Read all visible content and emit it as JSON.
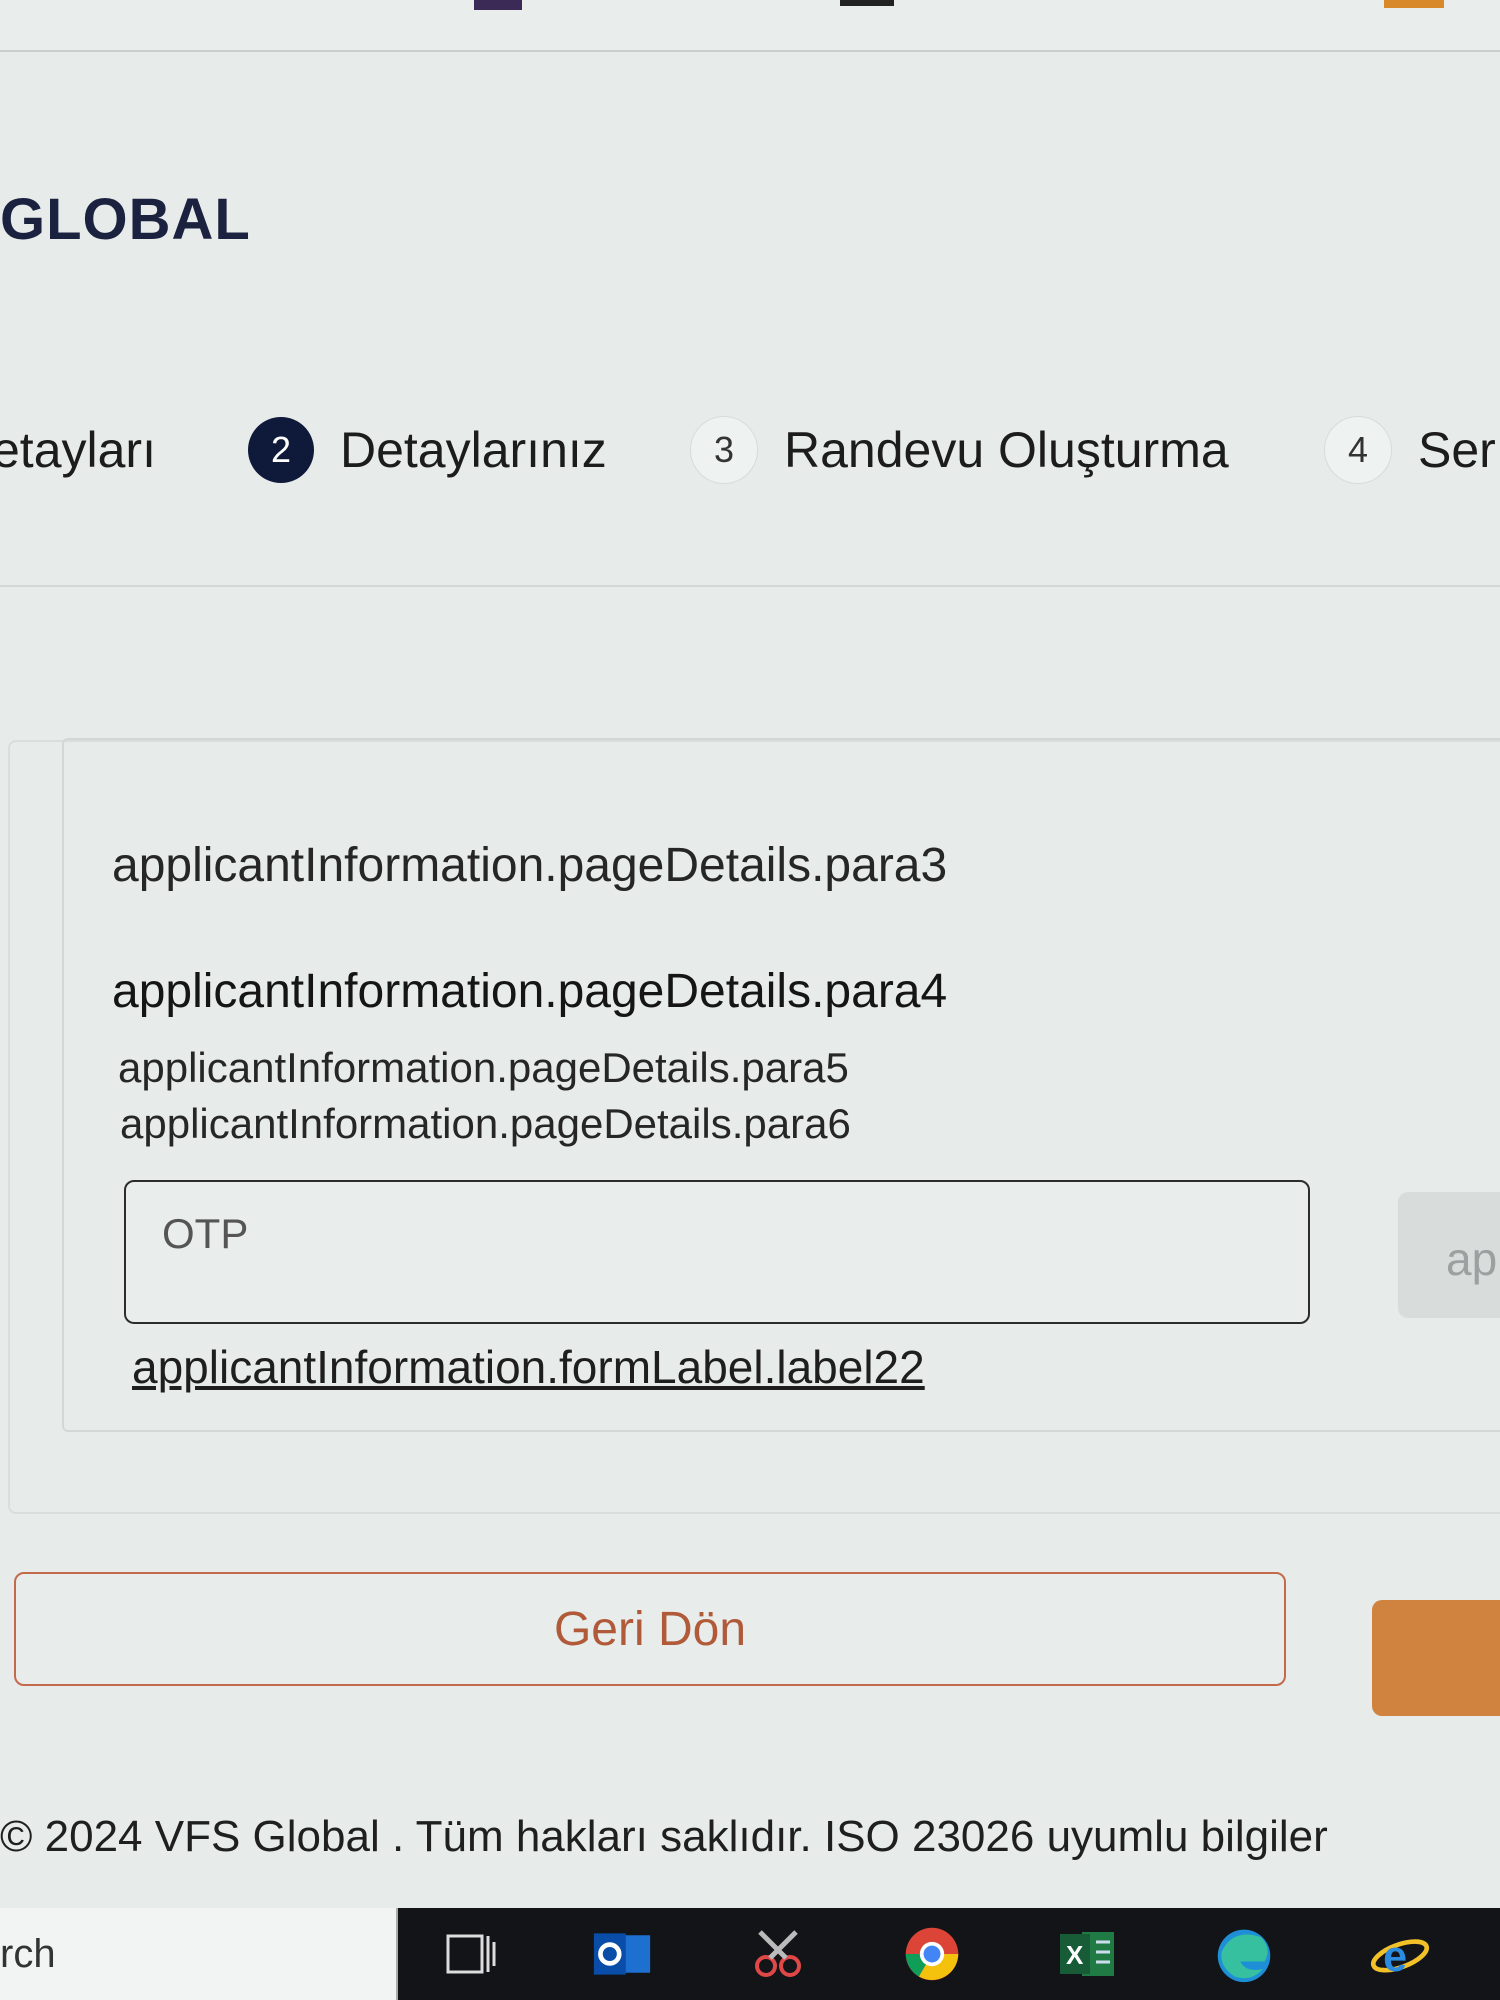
{
  "brand": {
    "logo_text": "GLOBAL"
  },
  "stepper": {
    "steps": [
      {
        "label": "etayları"
      },
      {
        "number": "2",
        "label": "Detaylarınız"
      },
      {
        "number": "3",
        "label": "Randevu Oluşturma"
      },
      {
        "number": "4",
        "label": "Ser"
      }
    ]
  },
  "form": {
    "para3": "applicantInformation.pageDetails.para3",
    "para4": "applicantInformation.pageDetails.para4",
    "para5": "applicantInformation.pageDetails.para5",
    "para6": "applicantInformation.pageDetails.para6",
    "otp_placeholder": "OTP",
    "side_button_label": "ap",
    "resend_link": "applicantInformation.formLabel.label22"
  },
  "actions": {
    "back_label": "Geri Dön"
  },
  "footer": {
    "text": "© 2024 VFS Global . Tüm hakları saklıdır. ISO 23026 uyumlu bilgiler"
  },
  "taskbar": {
    "search_text": "rch",
    "icons": [
      "task-view-icon",
      "outlook-icon",
      "snipping-tool-icon",
      "chrome-icon",
      "excel-icon",
      "edge-icon",
      "internet-explorer-icon"
    ]
  },
  "colors": {
    "active_step": "#0f1a3a",
    "back_button": "#b05a3a",
    "next_button": "#d0823f",
    "logo": "#1b2240"
  }
}
